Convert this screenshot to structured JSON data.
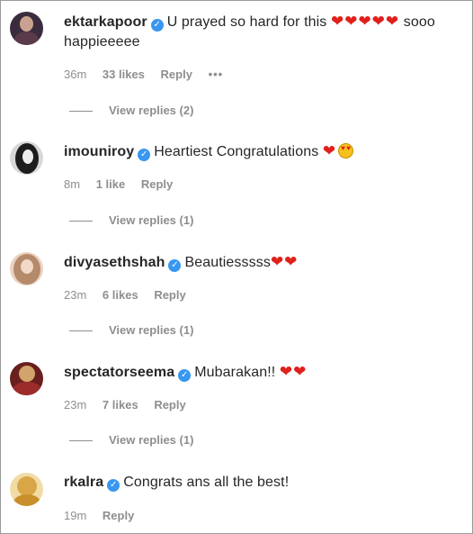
{
  "comments": [
    {
      "username": "ektarkapoor",
      "text": "U prayed so hard for this",
      "emojis": "❤❤❤❤❤",
      "text_tail": "sooo",
      "text_line2": "happieeeee",
      "time": "36m",
      "likes": "33 likes",
      "reply": "Reply",
      "more": "•••",
      "view_replies": "View replies (2)",
      "avatar_colors": [
        "#3b2c3d",
        "#c9a28f"
      ]
    },
    {
      "username": "imouniroy",
      "text": "Heartiest Congratulations",
      "emojis": "❤",
      "time": "8m",
      "likes": "1 like",
      "reply": "Reply",
      "view_replies": "View replies (1)",
      "avatar_colors": [
        "#1d1d1d",
        "#d8d8d8"
      ]
    },
    {
      "username": "divyasethshah",
      "text": "Beautiesssss",
      "emojis": "❤❤",
      "time": "23m",
      "likes": "6 likes",
      "reply": "Reply",
      "view_replies": "View replies (1)",
      "avatar_colors": [
        "#b58a6a",
        "#e8d2c2"
      ]
    },
    {
      "username": "spectatorseema",
      "text": "Mubarakan!!",
      "emojis": "❤❤",
      "time": "23m",
      "likes": "7 likes",
      "reply": "Reply",
      "view_replies": "View replies (1)",
      "avatar_colors": [
        "#6a1f1f",
        "#d0a46a"
      ]
    },
    {
      "username": "rkalra",
      "text": "Congrats ans all the best!",
      "time": "19m",
      "reply": "Reply",
      "avatar_colors": [
        "#d9a647",
        "#f1dca6"
      ]
    }
  ],
  "icons": {
    "verified": "verified-badge-icon",
    "heart": "red-heart-emoji-icon",
    "star_eyes": "star-struck-emoji-icon",
    "more": "more-options-icon"
  },
  "colors": {
    "text": "#262626",
    "meta": "#8e8e8e",
    "verified": "#3897f0",
    "heart": "#e0201b"
  }
}
